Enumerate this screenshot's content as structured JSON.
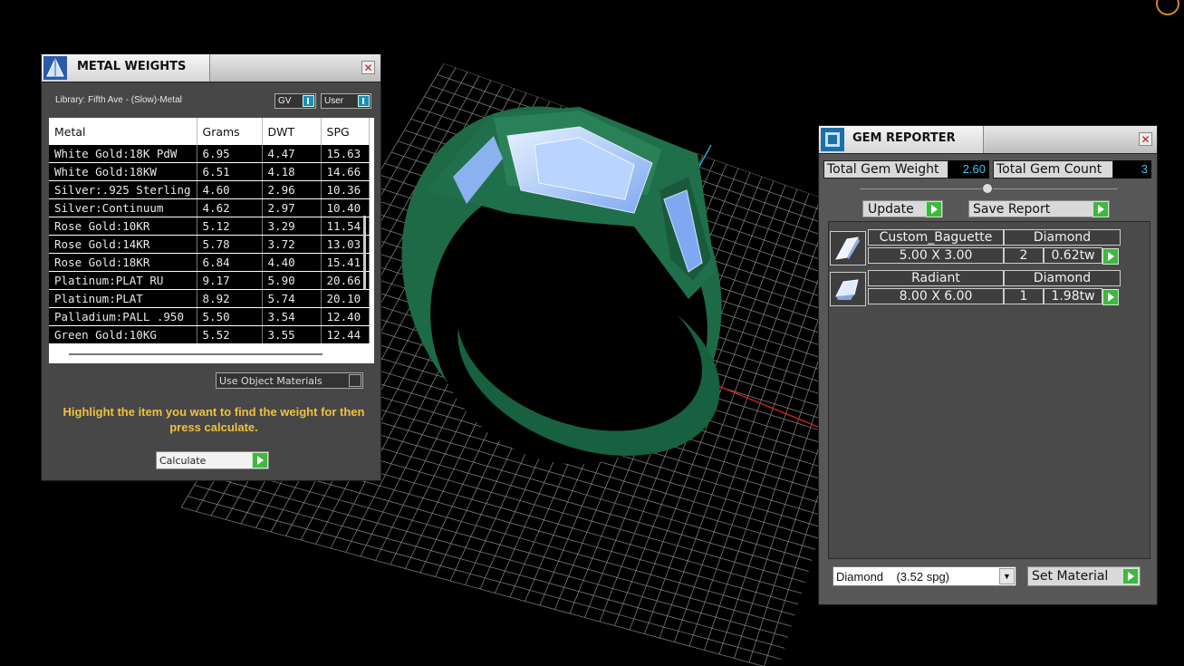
{
  "metal_weights": {
    "title": "METAL WEIGHTS",
    "close": "✕",
    "library_label": "Library: Fifth Ave - (Slow)-Metal",
    "toggle_gv": "GV",
    "toggle_user": "User",
    "columns": [
      "Metal",
      "Grams",
      "DWT",
      "SPG"
    ],
    "rows": [
      [
        "White Gold:18K PdW",
        "6.95",
        "4.47",
        "15.63"
      ],
      [
        "White Gold:18KW",
        "6.51",
        "4.18",
        "14.66"
      ],
      [
        "Silver:.925 Sterling",
        "4.60",
        "2.96",
        "10.36"
      ],
      [
        "Silver:Continuum",
        "4.62",
        "2.97",
        "10.40"
      ],
      [
        "Rose Gold:10KR",
        "5.12",
        "3.29",
        "11.54"
      ],
      [
        "Rose Gold:14KR",
        "5.78",
        "3.72",
        "13.03"
      ],
      [
        "Rose Gold:18KR",
        "6.84",
        "4.40",
        "15.41"
      ],
      [
        "Platinum:PLAT RU",
        "9.17",
        "5.90",
        "20.66"
      ],
      [
        "Platinum:PLAT",
        "8.92",
        "5.74",
        "20.10"
      ],
      [
        "Palladium:PALL .950",
        "5.50",
        "3.54",
        "12.40"
      ],
      [
        "Green Gold:10KG",
        "5.52",
        "3.55",
        "12.44"
      ]
    ],
    "use_object_materials": "Use Object Materials",
    "message": "Highlight the item you want to find the weight for then press calculate.",
    "calculate": "Calculate"
  },
  "gem_reporter": {
    "title": "GEM REPORTER",
    "close": "✕",
    "total_weight_label": "Total Gem Weight",
    "total_weight_value": "2.60",
    "total_count_label": "Total Gem Count",
    "total_count_value": "3",
    "update": "Update",
    "save_report": "Save Report",
    "gems": [
      {
        "cut": "Custom_Baguette",
        "material": "Diamond",
        "size": "5.00 X 3.00",
        "count": "2",
        "weight": "0.62tw"
      },
      {
        "cut": "Radiant",
        "material": "Diamond",
        "size": "8.00 X 6.00",
        "count": "1",
        "weight": "1.98tw"
      }
    ],
    "material_select": "Diamond    (3.52 spg)",
    "set_material": "Set Material"
  },
  "colors": {
    "ring_green": "#1f6f4a",
    "gem_blue": "#9fc7ff",
    "play_green": "#3fb83f",
    "value_cyan": "#3fc6e8",
    "msg_yellow": "#f0c040"
  }
}
